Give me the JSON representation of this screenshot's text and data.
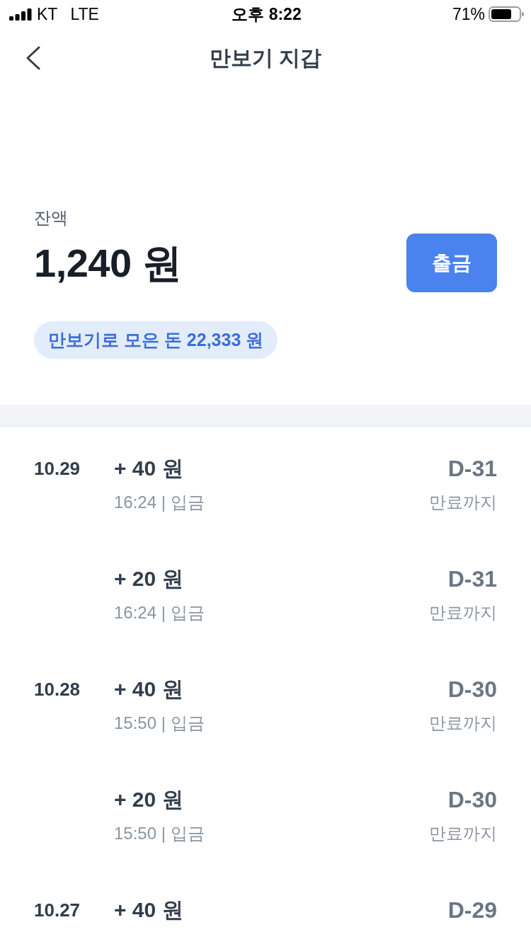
{
  "status_bar": {
    "carrier": "KT",
    "network": "LTE",
    "time": "오후 8:22",
    "battery": "71%"
  },
  "nav": {
    "title": "만보기 지갑"
  },
  "balance": {
    "label": "잔액",
    "amount": "1,240 원",
    "withdraw_button": "출금",
    "total_badge": "만보기로 모은 돈 22,333 원"
  },
  "transactions": [
    {
      "date": "10.29",
      "amount": "+ 40 원",
      "detail": "16:24 | 입금",
      "d_day": "D-31",
      "d_day_label": "만료까지"
    },
    {
      "amount": "+ 20 원",
      "detail": "16:24 | 입금",
      "d_day": "D-31",
      "d_day_label": "만료까지"
    },
    {
      "date": "10.28",
      "amount": "+ 40 원",
      "detail": "15:50 | 입금",
      "d_day": "D-30",
      "d_day_label": "만료까지"
    },
    {
      "amount": "+ 20 원",
      "detail": "15:50 | 입금",
      "d_day": "D-30",
      "d_day_label": "만료까지"
    },
    {
      "date": "10.27",
      "amount": "+ 40 원",
      "d_day": "D-29"
    }
  ]
}
